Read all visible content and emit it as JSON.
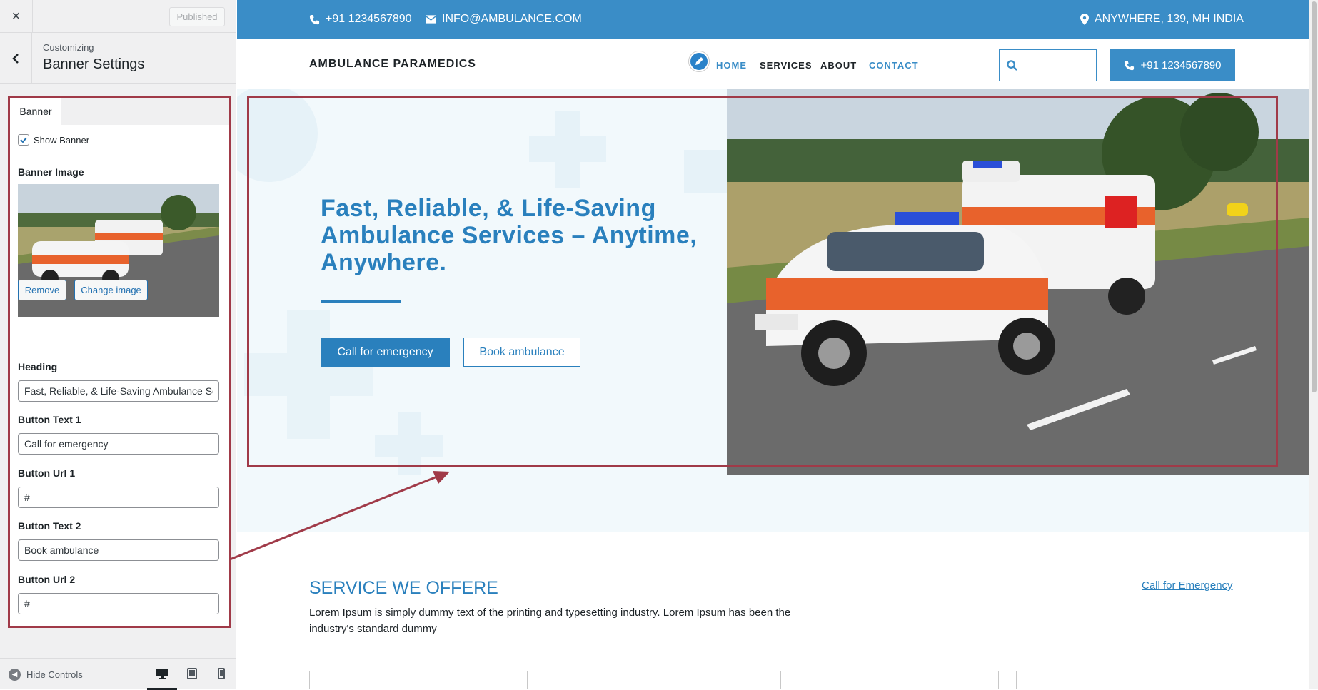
{
  "customizer": {
    "close_label": "×",
    "publish_label": "Published",
    "customizing_label": "Customizing",
    "section_title": "Banner Settings",
    "tab_label": "Banner",
    "show_banner_label": "Show Banner",
    "show_banner_checked": true,
    "banner_image_label": "Banner Image",
    "remove_label": "Remove",
    "change_image_label": "Change image",
    "heading_label": "Heading",
    "heading_value": "Fast, Reliable, & Life-Saving Ambulance Services – Anytime, Anywhere.",
    "button_text_1_label": "Button Text 1",
    "button_text_1_value": "Call for emergency",
    "button_url_1_label": "Button Url 1",
    "button_url_1_value": "#",
    "button_text_2_label": "Button Text 2",
    "button_text_2_value": "Book ambulance",
    "button_url_2_label": "Button Url 2",
    "button_url_2_value": "#",
    "hide_controls_label": "Hide Controls",
    "devices": [
      "desktop-icon",
      "tablet-icon",
      "mobile-icon"
    ]
  },
  "site": {
    "phone": "+91 1234567890",
    "email": "INFO@AMBULANCE.COM",
    "address": "ANYWHERE, 139, MH INDIA",
    "brand": "AMBULANCE PARAMEDICS",
    "nav": [
      {
        "label": "HOME",
        "active": true
      },
      {
        "label": "SERVICES",
        "active": false
      },
      {
        "label": "ABOUT",
        "active": false
      },
      {
        "label": "CONTACT",
        "active": false
      }
    ],
    "call_button": "+91 1234567890",
    "hero": {
      "heading": "Fast, Reliable, & Life-Saving Ambulance Services – Anytime, Anywhere.",
      "button_1": "Call for emergency",
      "button_2": "Book ambulance"
    },
    "services": {
      "title": "SERVICE WE OFFERE",
      "link": "Call for Emergency",
      "description": "Lorem Ipsum is simply dummy text of the printing and typesetting industry. Lorem Ipsum has been the industry's standard dummy"
    }
  },
  "colors": {
    "accent": "#3a8dc7",
    "highlight": "#a03a48",
    "heading_blue": "#2a80bd"
  }
}
